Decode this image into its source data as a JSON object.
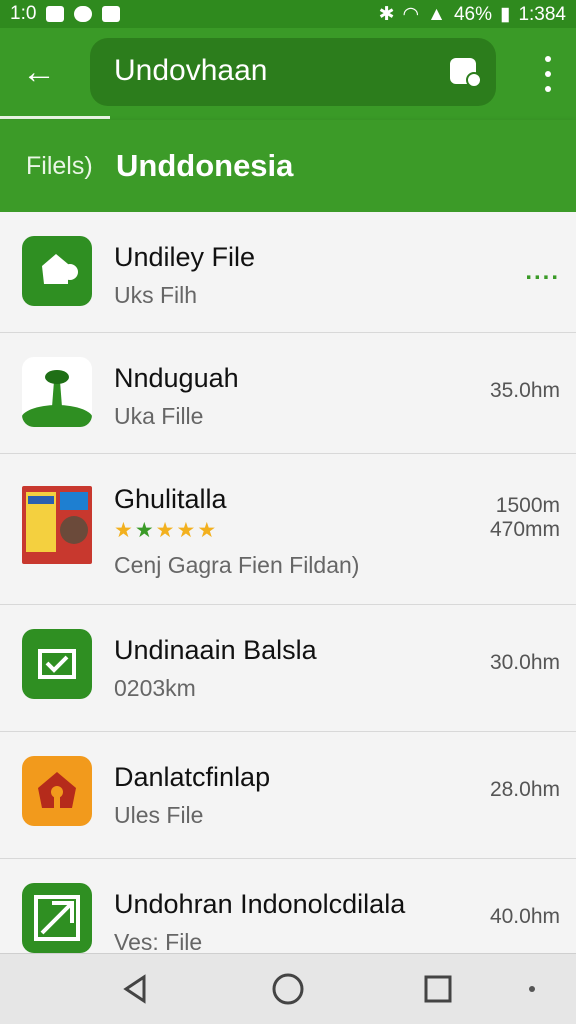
{
  "status_bar": {
    "left_time": "1:0",
    "battery": "46%",
    "right_time": "1:384"
  },
  "app_bar": {
    "search_title": "Undovhaan"
  },
  "subheader": {
    "crumb": "Filels)",
    "heading": "Unddonesia"
  },
  "items": [
    {
      "name": "Undiley File",
      "subtitle": "Uks Filh",
      "meta": "....",
      "icon": "thumbs-up-icon",
      "color": "#2f8f22"
    },
    {
      "name": "Nnduguah",
      "subtitle": "Uka Fille",
      "meta": "35.0hm",
      "icon": "landscape-icon",
      "color": "#ffffff"
    },
    {
      "name": "Ghulitalla",
      "subtitle": "Cenj Gagra Fien Fildan)",
      "meta": "1500m",
      "meta2": "470mm",
      "rating": 5,
      "icon": "poster-icon",
      "color": "#c8382e"
    },
    {
      "name": "Undinaain Balsla",
      "subtitle": "0203km",
      "meta": "30.0hm",
      "icon": "inbox-check-icon",
      "color": "#2f8f22"
    },
    {
      "name": "Danlatcfinlap",
      "subtitle": "Ules File",
      "meta": "28.0hm",
      "icon": "home-icon",
      "color": "#f29a1c"
    },
    {
      "name": "Undohran Indonolcdilala",
      "subtitle": "Ves: File",
      "meta": "40.0hm",
      "icon": "send-icon",
      "color": "#2f8f22"
    }
  ],
  "nav": {
    "buttons": [
      "back-nav-icon",
      "home-nav-icon",
      "recents-nav-icon"
    ]
  }
}
